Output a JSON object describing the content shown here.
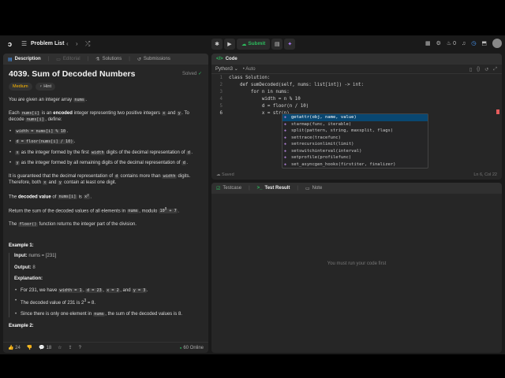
{
  "nav": {
    "problem_list": "Problem List",
    "submit": "Submit",
    "streak": "0"
  },
  "description": {
    "tabs": [
      "Description",
      "Editorial",
      "Solutions",
      "Submissions"
    ],
    "title": "4039. Sum of Decoded Numbers",
    "solved": "Solved",
    "difficulty": "Medium",
    "hint": "Hint",
    "intro_1": "You are given an integer array ",
    "intro_code": "nums",
    "p2_a": "Each ",
    "p2_code1": "nums[i]",
    "p2_b": " is an ",
    "p2_bold": "encoded",
    "p2_c": " integer representing two positive integers ",
    "p2_code2": "x",
    "p2_d": " and ",
    "p2_code3": "y",
    "p2_e": ". To decode ",
    "p2_code4": "nums[i]",
    "p2_f": ", define:",
    "bullet1_code": "width = nums[i] % 10",
    "bullet2_code": "d = floor(nums[i] / 10)",
    "bullet3_a": " as the integer formed by the first ",
    "bullet3_code": "width",
    "bullet3_b": " digits of the decimal representation of ",
    "bullet4_a": " as the integer formed by all remaining digits of the decimal representation of ",
    "p3_a": "It is guaranteed that the decimal representation of ",
    "p3_b": " contains more than ",
    "p3_code": "width",
    "p3_c": " digits. Therefore, both ",
    "p3_d": " and ",
    "p3_e": " contain at least one digit.",
    "p4_bold": "decoded value",
    "p4_a": "The ",
    "p4_b": " of ",
    "p4_code1": "nums[i]",
    "p4_c": " is ",
    "p4_code2": "x",
    "p5_a": "Return the sum of the decoded values of all elements in ",
    "p5_code1": "nums",
    "p5_b": ", modulo ",
    "p5_code2": "10",
    "p6_a": "The ",
    "p6_code": "floor()",
    "p6_b": " function returns the integer part of the division.",
    "example1": "Example 1:",
    "input_label": "Input:",
    "input_value": "nums = [231]",
    "output_label": "Output:",
    "output_value": "8",
    "explanation_label": "Explanation:",
    "exp1_a": "For 231, we have ",
    "exp1_c1": "width = 1",
    "exp1_c2": "d = 23",
    "exp1_c3": "x = 2",
    "exp1_c4": "y = 3",
    "exp2_a": "The decoded value of 231 is 2",
    "exp3_a": "Since there is only one element in ",
    "exp3_code": "nums",
    "exp3_b": ", the sum of the decoded values is 8.",
    "example2": "Example 2:",
    "likes": "24",
    "comments": "18",
    "online": "60 Online"
  },
  "code": {
    "tab": "Code",
    "language": "Python3",
    "auto": "Auto",
    "lines": [
      "class Solution:",
      "    def sumDecoded(self, nums: list[int]) -> int:",
      "        for n in nums:",
      "            width = n % 10",
      "            d = floor(n / 10)",
      "            x = str(n)"
    ],
    "autocomplete": [
      "getattr(obj, name, value)",
      "starmap(func, iterable)",
      "split(pattern, string, maxsplit, flags)",
      "settrace(tracefunc)",
      "setrecursionlimit(limit)",
      "setswitchinterval(interval)",
      "setprofile(profilefunc)",
      "set_asyncgen_hooks(firstiter, finalizer)"
    ],
    "saved": "Saved",
    "cursor": "Ln 6, Col 22"
  },
  "test": {
    "tabs": [
      "Testcase",
      "Test Result",
      "Note"
    ],
    "message": "You must run your code first"
  }
}
